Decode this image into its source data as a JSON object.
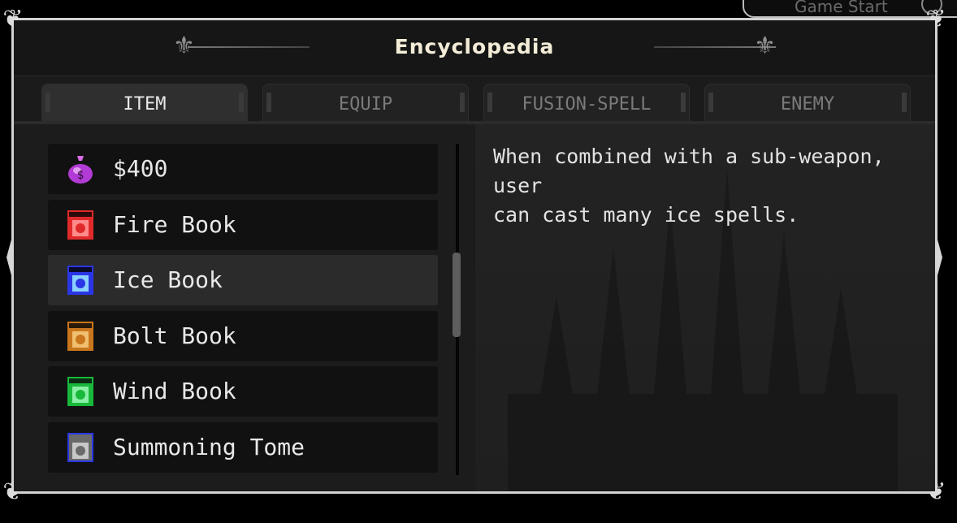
{
  "top_button": {
    "label": "Game Start",
    "icon": "circle-button-icon"
  },
  "window": {
    "title": "Encyclopedia"
  },
  "tabs": [
    {
      "label": "ITEM",
      "active": true
    },
    {
      "label": "EQUIP",
      "active": false
    },
    {
      "label": "FUSION-SPELL",
      "active": false
    },
    {
      "label": "ENEMY",
      "active": false
    }
  ],
  "items": [
    {
      "label": "$400",
      "icon": "money-bag-icon",
      "color": "#b23bd6"
    },
    {
      "label": "Fire Book",
      "icon": "fire-book-icon",
      "color": "#e02a2a"
    },
    {
      "label": "Ice Book",
      "icon": "ice-book-icon",
      "color": "#2a36e6"
    },
    {
      "label": "Bolt Book",
      "icon": "bolt-book-icon",
      "color": "#c9761c"
    },
    {
      "label": "Wind Book",
      "icon": "wind-book-icon",
      "color": "#18b83a"
    },
    {
      "label": "Summoning Tome",
      "icon": "summoning-tome-icon",
      "color": "#6a6a6a"
    }
  ],
  "selected_index": 2,
  "description": "When combined with a sub-weapon, user\ncan cast many ice spells."
}
